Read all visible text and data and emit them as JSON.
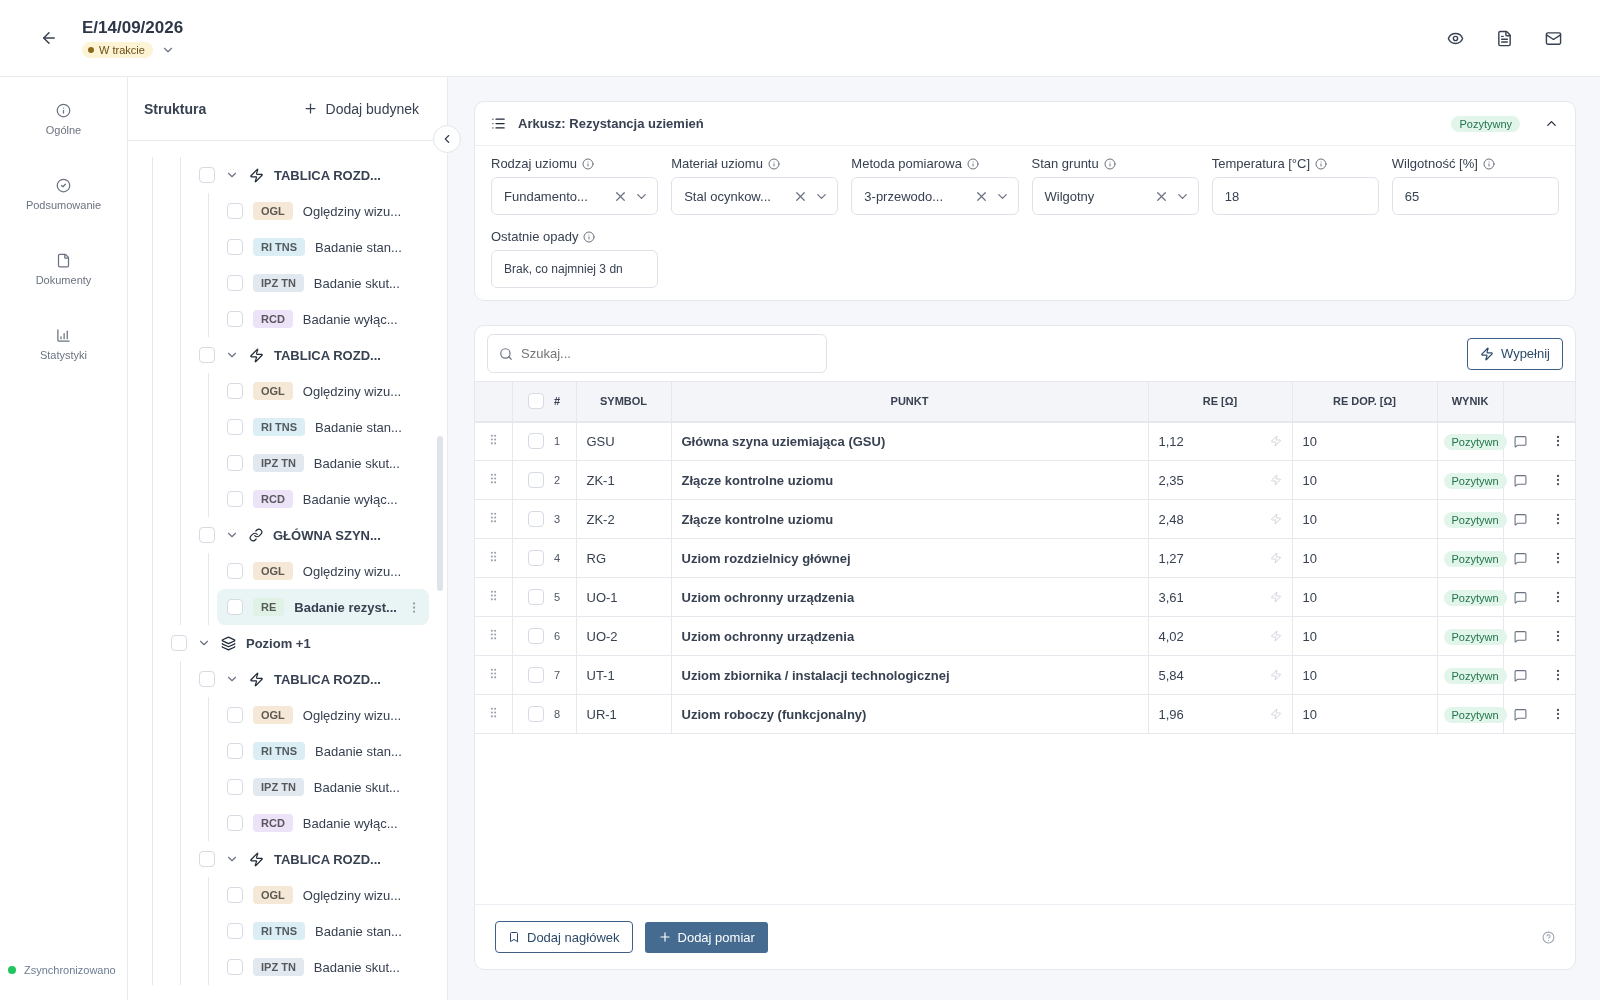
{
  "header": {
    "title": "E/14/09/2026",
    "status": "W trakcie"
  },
  "nav": [
    {
      "label": "Ogólne",
      "kind": "info",
      "selected": false
    },
    {
      "label": "Podsumowanie",
      "kind": "check",
      "selected": false
    },
    {
      "label": "Dokumenty",
      "kind": "doc",
      "selected": false
    },
    {
      "label": "Statystyki",
      "kind": "stats",
      "selected": false
    }
  ],
  "sync": {
    "label": "Zsynchronizowano",
    "color": "#22c55e"
  },
  "structure": {
    "title": "Struktura",
    "add_button": "Dodaj budynek",
    "tree": [
      {
        "children": [
          {
            "kind": "panel",
            "label": "TABLICA ROZD...",
            "checked": false,
            "expanded": true,
            "children": [
              {
                "kind": "test",
                "tag": "OGL",
                "color": "#f5e8d6",
                "label": "Oględziny wizu...",
                "checked": false,
                "selected": false
              },
              {
                "kind": "test",
                "tag": "RI TNS",
                "color": "#dbeef5",
                "label": "Badanie stan...",
                "checked": false,
                "selected": false
              },
              {
                "kind": "test",
                "tag": "IPZ TN",
                "color": "#e2e8ef",
                "label": "Badanie skut...",
                "checked": false,
                "selected": false
              },
              {
                "kind": "test",
                "tag": "RCD",
                "color": "#ece3f8",
                "label": "Badanie wyłąc...",
                "checked": false,
                "selected": false
              }
            ]
          },
          {
            "kind": "panel",
            "label": "TABLICA ROZD...",
            "checked": false,
            "expanded": true,
            "children": [
              {
                "kind": "test",
                "tag": "OGL",
                "color": "#f5e8d6",
                "label": "Oględziny wizu...",
                "checked": false,
                "selected": false
              },
              {
                "kind": "test",
                "tag": "RI TNS",
                "color": "#dbeef5",
                "label": "Badanie stan...",
                "checked": false,
                "selected": false
              },
              {
                "kind": "test",
                "tag": "IPZ TN",
                "color": "#e2e8ef",
                "label": "Badanie skut...",
                "checked": false,
                "selected": false
              },
              {
                "kind": "test",
                "tag": "RCD",
                "color": "#ece3f8",
                "label": "Badanie wyłąc...",
                "checked": false,
                "selected": false
              }
            ]
          },
          {
            "kind": "busbar",
            "label": "GŁÓWNA SZYN...",
            "checked": false,
            "expanded": true,
            "children": [
              {
                "kind": "test",
                "tag": "OGL",
                "color": "#f5e8d6",
                "label": "Oględziny wizu...",
                "checked": false,
                "selected": false
              },
              {
                "kind": "test",
                "tag": "RE",
                "color": "#e0f2e6",
                "label": "Badanie rezyst...",
                "checked": false,
                "selected": true
              }
            ]
          }
        ]
      },
      {
        "kind": "level",
        "label": "Poziom +1",
        "checked": false,
        "expanded": true,
        "children": [
          {
            "kind": "panel",
            "label": "TABLICA ROZD...",
            "checked": false,
            "expanded": true,
            "children": [
              {
                "kind": "test",
                "tag": "OGL",
                "color": "#f5e8d6",
                "label": "Oględziny wizu...",
                "checked": false,
                "selected": false
              },
              {
                "kind": "test",
                "tag": "RI TNS",
                "color": "#dbeef5",
                "label": "Badanie stan...",
                "checked": false,
                "selected": false
              },
              {
                "kind": "test",
                "tag": "IPZ TN",
                "color": "#e2e8ef",
                "label": "Badanie skut...",
                "checked": false,
                "selected": false
              },
              {
                "kind": "test",
                "tag": "RCD",
                "color": "#ece3f8",
                "label": "Badanie wyłąc...",
                "checked": false,
                "selected": false
              }
            ]
          },
          {
            "kind": "panel",
            "label": "TABLICA ROZD...",
            "checked": false,
            "expanded": true,
            "children": [
              {
                "kind": "test",
                "tag": "OGL",
                "color": "#f5e8d6",
                "label": "Oględziny wizu...",
                "checked": false,
                "selected": false
              },
              {
                "kind": "test",
                "tag": "RI TNS",
                "color": "#dbeef5",
                "label": "Badanie stan...",
                "checked": false,
                "selected": false
              },
              {
                "kind": "test",
                "tag": "IPZ TN",
                "color": "#e2e8ef",
                "label": "Badanie skut...",
                "checked": false,
                "selected": false
              }
            ]
          }
        ]
      }
    ]
  },
  "sheet": {
    "title": "Arkusz: Rezystancja uziemień",
    "result": "Pozytywny",
    "expanded": true,
    "fields": [
      {
        "kind": "select",
        "label": "Rodzaj uziomu",
        "value": "Fundamento..."
      },
      {
        "kind": "select",
        "label": "Materiał uziomu",
        "value": "Stal ocynkow..."
      },
      {
        "kind": "select",
        "label": "Metoda pomiarowa",
        "value": "3-przewodo..."
      },
      {
        "kind": "select",
        "label": "Stan gruntu",
        "value": "Wilgotny"
      },
      {
        "kind": "input",
        "label": "Temperatura [°C]",
        "value": "18"
      },
      {
        "kind": "input",
        "label": "Wilgotność [%]",
        "value": "65"
      },
      {
        "kind": "input",
        "label": "Ostatnie opady",
        "value": "Brak, co najmniej 3 dn"
      }
    ]
  },
  "measurements": {
    "search": {
      "placeholder": "Szukaj..."
    },
    "fill_button": "Wypełnij",
    "all_checked": false,
    "columns": [
      "#",
      "SYMBOL",
      "PUNKT",
      "RE [Ω]",
      "RE DOP. [Ω]",
      "WYNIK"
    ],
    "rows": [
      {
        "no": "1",
        "symbol": "GSU",
        "point": "Główna szyna uziemiająca (GSU)",
        "re": "1,12",
        "re_max": "10",
        "result": "Pozytywn",
        "checked": false
      },
      {
        "no": "2",
        "symbol": "ZK-1",
        "point": "Złącze kontrolne uziomu",
        "re": "2,35",
        "re_max": "10",
        "result": "Pozytywn",
        "checked": false
      },
      {
        "no": "3",
        "symbol": "ZK-2",
        "point": "Złącze kontrolne uziomu",
        "re": "2,48",
        "re_max": "10",
        "result": "Pozytywn",
        "checked": false
      },
      {
        "no": "4",
        "symbol": "RG",
        "point": "Uziom rozdzielnicy głównej",
        "re": "1,27",
        "re_max": "10",
        "result": "Pozytywn",
        "checked": false
      },
      {
        "no": "5",
        "symbol": "UO-1",
        "point": "Uziom ochronny urządzenia",
        "re": "3,61",
        "re_max": "10",
        "result": "Pozytywn",
        "checked": false
      },
      {
        "no": "6",
        "symbol": "UO-2",
        "point": "Uziom ochronny urządzenia",
        "re": "4,02",
        "re_max": "10",
        "result": "Pozytywn",
        "checked": false
      },
      {
        "no": "7",
        "symbol": "UT-1",
        "point": "Uziom zbiornika / instalacji technologicznej",
        "re": "5,84",
        "re_max": "10",
        "result": "Pozytywn",
        "checked": false
      },
      {
        "no": "8",
        "symbol": "UR-1",
        "point": "Uziom roboczy (funkcjonalny)",
        "re": "1,96",
        "re_max": "10",
        "result": "Pozytywn",
        "checked": false
      }
    ],
    "add_header_button": "Dodaj nagłówek",
    "add_measurement_button": "Dodaj pomiar"
  }
}
